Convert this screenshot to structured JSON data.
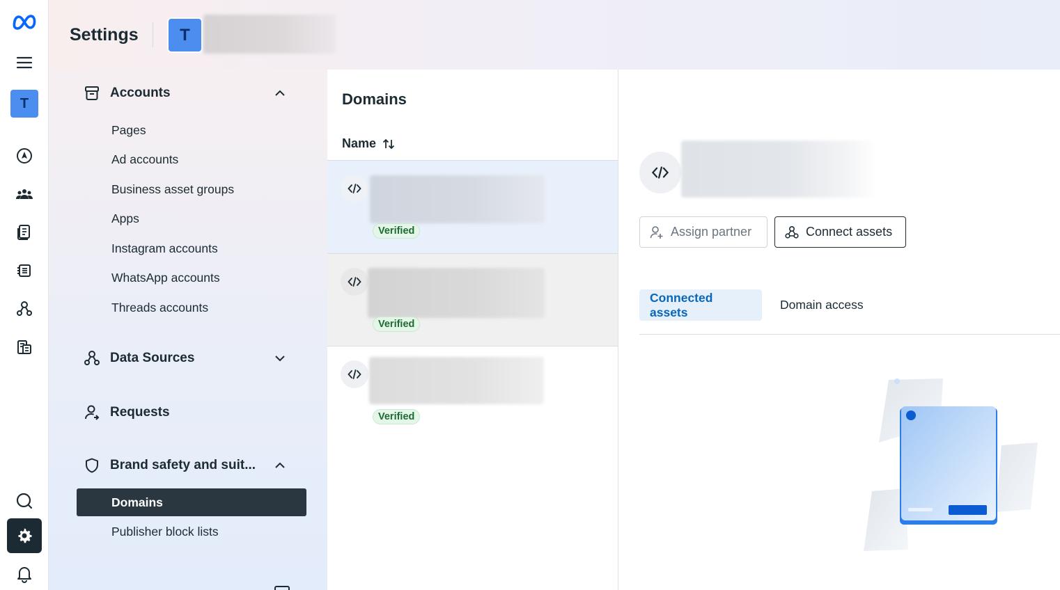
{
  "app": {
    "title": "Settings",
    "business_initial": "T"
  },
  "rail": {
    "avatar_initial": "T",
    "icons": [
      "meta-logo-icon",
      "menu-icon",
      "business-avatar",
      "compass-icon",
      "people-icon",
      "pages-icon",
      "inbox-icon",
      "integrations-icon",
      "billing-icon",
      "search-icon",
      "settings-icon",
      "bell-icon"
    ]
  },
  "nav": {
    "accounts": {
      "label": "Accounts",
      "items": [
        "Pages",
        "Ad accounts",
        "Business asset groups",
        "Apps",
        "Instagram accounts",
        "WhatsApp accounts",
        "Threads accounts"
      ]
    },
    "data_sources": {
      "label": "Data Sources"
    },
    "requests": {
      "label": "Requests"
    },
    "brand_safety": {
      "label": "Brand safety and suit...",
      "items": [
        "Domains",
        "Publisher block lists"
      ]
    }
  },
  "list": {
    "title": "Domains",
    "column_header": "Name",
    "rows": [
      {
        "status": "Verified",
        "selected": true
      },
      {
        "status": "Verified",
        "selected": false
      },
      {
        "status": "Verified",
        "selected": false
      }
    ]
  },
  "detail": {
    "assign_partner": "Assign partner",
    "connect_assets": "Connect assets",
    "tabs": [
      "Connected assets",
      "Domain access"
    ],
    "active_tab": "Connected assets"
  },
  "colors": {
    "accent": "#0a66b8",
    "dark": "#1c2b33",
    "verified_text": "#1d6b32",
    "selected_row": "#e7f0fb"
  }
}
